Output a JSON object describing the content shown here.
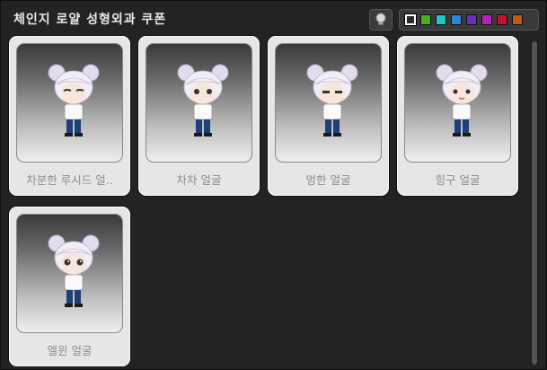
{
  "window": {
    "title": "체인지 로얄 성형외과 쿠폰"
  },
  "toolbar": {
    "preview_icon": "lightbulb-icon",
    "colors": [
      {
        "name": "white",
        "hex": "#2b2b2b",
        "selected": true
      },
      {
        "name": "green",
        "hex": "#4caf23"
      },
      {
        "name": "cyan",
        "hex": "#20c7c7"
      },
      {
        "name": "blue",
        "hex": "#2f86d6"
      },
      {
        "name": "purple",
        "hex": "#6b2fb6"
      },
      {
        "name": "magenta",
        "hex": "#b423b4"
      },
      {
        "name": "red",
        "hex": "#c0132f"
      },
      {
        "name": "orange",
        "hex": "#c05a1a"
      }
    ]
  },
  "faces": [
    {
      "label": "차분한 루시드 얼.."
    },
    {
      "label": "차차 얼굴"
    },
    {
      "label": "멍한 얼굴"
    },
    {
      "label": "힝구 얼굴"
    },
    {
      "label": "엘윈 얼굴"
    }
  ]
}
